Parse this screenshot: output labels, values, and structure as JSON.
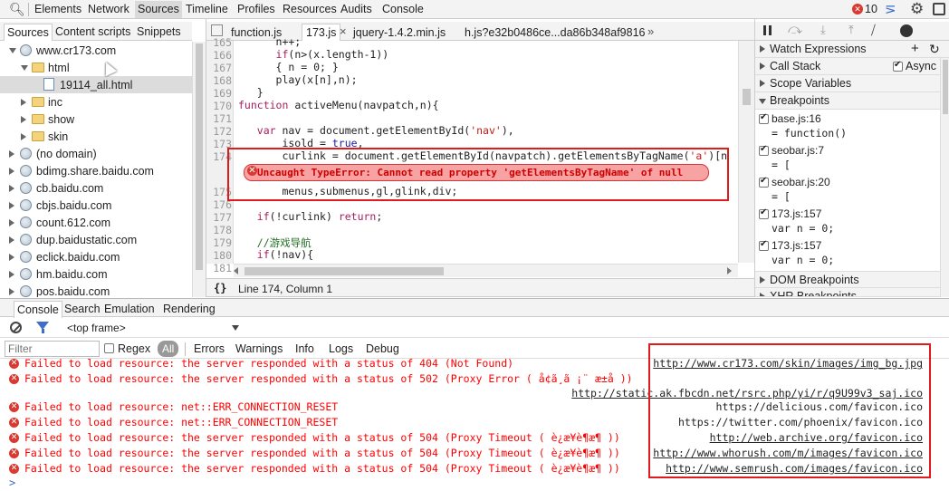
{
  "topbar": {
    "tabs": [
      "Elements",
      "Network",
      "Sources",
      "Timeline",
      "Profiles",
      "Resources",
      "Audits",
      "Console"
    ],
    "error_count": "10"
  },
  "sources": {
    "tabs": [
      "Sources",
      "Content scripts",
      "Snippets"
    ],
    "tree": [
      {
        "label": "www.cr173.com",
        "type": "domain",
        "open": true,
        "indent": 0
      },
      {
        "label": "html",
        "type": "folder",
        "open": true,
        "indent": 1
      },
      {
        "label": "19114_all.html",
        "type": "file",
        "open": false,
        "indent": 2,
        "selected": true
      },
      {
        "label": "inc",
        "type": "folder",
        "open": false,
        "indent": 1
      },
      {
        "label": "show",
        "type": "folder",
        "open": false,
        "indent": 1
      },
      {
        "label": "skin",
        "type": "folder",
        "open": false,
        "indent": 1
      },
      {
        "label": "(no domain)",
        "type": "domain",
        "open": false,
        "indent": 0
      },
      {
        "label": "bdimg.share.baidu.com",
        "type": "domain",
        "open": false,
        "indent": 0
      },
      {
        "label": "cb.baidu.com",
        "type": "domain",
        "open": false,
        "indent": 0
      },
      {
        "label": "cbjs.baidu.com",
        "type": "domain",
        "open": false,
        "indent": 0
      },
      {
        "label": "count.612.com",
        "type": "domain",
        "open": false,
        "indent": 0
      },
      {
        "label": "dup.baidustatic.com",
        "type": "domain",
        "open": false,
        "indent": 0
      },
      {
        "label": "eclick.baidu.com",
        "type": "domain",
        "open": false,
        "indent": 0
      },
      {
        "label": "hm.baidu.com",
        "type": "domain",
        "open": false,
        "indent": 0
      },
      {
        "label": "pos.baidu.com",
        "type": "domain",
        "open": false,
        "indent": 0
      }
    ]
  },
  "editor": {
    "file_tabs": [
      "function.js",
      "173.js",
      "jquery-1.4.2.min.js",
      "h.js?e32b0486ce...da86b348af9816"
    ],
    "active_tab_close": "×",
    "more_tabs": "»",
    "lines": [
      {
        "n": "165",
        "code": "      n++;"
      },
      {
        "n": "166",
        "code": "      if(n>(x.length-1))"
      },
      {
        "n": "167",
        "code": "      { n = 0; }"
      },
      {
        "n": "168",
        "code": "      play(x[n],n);"
      },
      {
        "n": "169",
        "code": "   }"
      },
      {
        "n": "170",
        "code": "function activeMenu(navpatch,n){"
      },
      {
        "n": "171",
        "code": ""
      },
      {
        "n": "172",
        "code": "   var nav = document.getElementById('nav'),"
      },
      {
        "n": "173",
        "code": "       isold = true,"
      },
      {
        "n": "174",
        "code": "       curlink = document.getElementById(navpatch).getElementsByTagName('a')[n"
      },
      {
        "n": "175",
        "code": "       menus,submenus,gl,glink,div;"
      },
      {
        "n": "176",
        "code": ""
      },
      {
        "n": "177",
        "code": "   if(!curlink) return;"
      },
      {
        "n": "178",
        "code": ""
      },
      {
        "n": "179",
        "code": "   //游戏导航"
      },
      {
        "n": "180",
        "code": "   if(!nav){"
      },
      {
        "n": "181",
        "code": ""
      }
    ],
    "error_bubble": "Uncaught TypeError: Cannot read property 'getElementsByTagName' of null",
    "status": "Line 174, Column 1",
    "status_icon": "{}"
  },
  "debugger": {
    "sections": {
      "watch": "Watch Expressions",
      "callstack": "Call Stack",
      "async": "Async",
      "scope": "Scope Variables",
      "breakpoints": "Breakpoints",
      "dom_breakpoints": "DOM Breakpoints",
      "xhr_breakpoints": "XHR Breakpoints"
    },
    "breakpoints": [
      {
        "file": "base.js:16",
        "code": "= function()"
      },
      {
        "file": "seobar.js:7",
        "code": "= ["
      },
      {
        "file": "seobar.js:20",
        "code": "= ["
      },
      {
        "file": "173.js:157",
        "code": "var n = 0;"
      },
      {
        "file": "173.js:157",
        "code": "var n = 0;"
      }
    ]
  },
  "drawer": {
    "tabs": [
      "Console",
      "Search",
      "Emulation",
      "Rendering"
    ],
    "frame": "<top frame>",
    "filter_placeholder": "Filter",
    "regex": "Regex",
    "levels": [
      "All",
      "Errors",
      "Warnings",
      "Info",
      "Logs",
      "Debug"
    ]
  },
  "console": {
    "messages": [
      {
        "text": "Failed to load resource: the server responded with a status of 404 (Not Found)",
        "url": "http://www.cr173.com/skin/images/img_bg.jpg",
        "link": true
      },
      {
        "text": "Failed to load resource: the server responded with a status of 502 (Proxy Error ( å¢ã¸ã ¡¨ æ±å ))",
        "url": "http://static.ak.fbcdn.net/rsrc.php/yi/r/q9U99v3_saj.ico",
        "link": true
      },
      {
        "text": "Failed to load resource: net::ERR_CONNECTION_RESET",
        "url": "https://delicious.com/favicon.ico",
        "link": false
      },
      {
        "text": "Failed to load resource: net::ERR_CONNECTION_RESET",
        "url": "https://twitter.com/phoenix/favicon.ico",
        "link": false
      },
      {
        "text": "Failed to load resource: the server responded with a status of 504 (Proxy Timeout ( è¿æ¥è¶æ¶ ))",
        "url": "http://web.archive.org/favicon.ico",
        "link": true
      },
      {
        "text": "Failed to load resource: the server responded with a status of 504 (Proxy Timeout ( è¿æ¥è¶æ¶ ))",
        "url": "http://www.whorush.com/m/images/favicon.ico",
        "link": true
      },
      {
        "text": "Failed to load resource: the server responded with a status of 504 (Proxy Timeout ( è¿æ¥è¶æ¶ ))",
        "url": "http://www.semrush.com/images/favicon.ico",
        "link": true
      }
    ],
    "prompt": ">"
  },
  "colors": {
    "highlight_box": "#e01b1b",
    "error_red": "#ff0000",
    "accent_blue": "#3f6ecb"
  }
}
